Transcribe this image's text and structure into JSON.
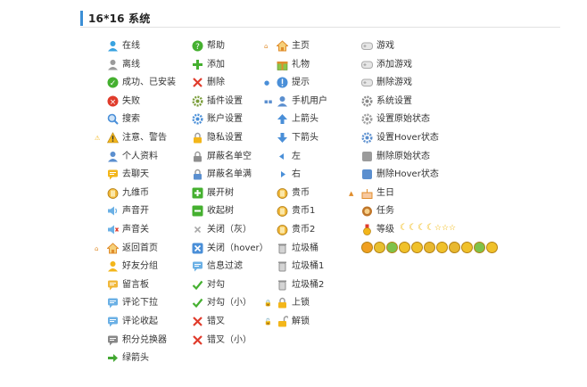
{
  "header": {
    "title": "16*16 系统"
  },
  "columns": [
    {
      "items": [
        {
          "label": "在线",
          "icon": "user-online-icon",
          "color": "#39a3e0"
        },
        {
          "label": "离线",
          "icon": "user-offline-icon",
          "color": "#9b9b9b"
        },
        {
          "label": "成功、已安装",
          "icon": "success-check-icon",
          "color": "#45b030"
        },
        {
          "label": "失败",
          "icon": "fail-x-icon",
          "color": "#e03c2c"
        },
        {
          "label": "搜索",
          "icon": "search-icon",
          "color": "#4a8fd8"
        },
        {
          "label": "注意、警告",
          "icon": "warning-icon",
          "color": "#f3b61a",
          "pre": "⚠"
        },
        {
          "label": "个人资料",
          "icon": "profile-card-icon",
          "color": "#5b8fcf"
        },
        {
          "label": "去聊天",
          "icon": "chat-icon",
          "color": "#f3b61a"
        },
        {
          "label": "九维币",
          "icon": "coin-bag-icon",
          "color": "#f1b83a"
        },
        {
          "label": "声音开",
          "icon": "sound-on-icon",
          "color": "#6bb0e5"
        },
        {
          "label": "声音关",
          "icon": "sound-off-icon",
          "color": "#6bb0e5"
        },
        {
          "label": "返回首页",
          "icon": "home-icon",
          "color": "#e08d2c",
          "pre": "⌂"
        },
        {
          "label": "好友分组",
          "icon": "friends-group-icon",
          "color": "#f3b61a"
        },
        {
          "label": "留言板",
          "icon": "message-board-icon",
          "color": "#f1b83a"
        },
        {
          "label": "评论下拉",
          "icon": "comment-expand-icon",
          "color": "#6bb0e5"
        },
        {
          "label": "评论收起",
          "icon": "comment-collapse-icon",
          "color": "#6bb0e5"
        },
        {
          "label": "积分兑换器",
          "icon": "points-exchange-icon",
          "color": "#888888"
        },
        {
          "label": "绿箭头",
          "icon": "green-arrow-icon",
          "color": "#43a832"
        }
      ]
    },
    {
      "items": [
        {
          "label": "帮助",
          "icon": "help-icon",
          "color": "#45b030"
        },
        {
          "label": "添加",
          "icon": "add-icon",
          "color": "#45b030"
        },
        {
          "label": "删除",
          "icon": "delete-icon",
          "color": "#e03c2c"
        },
        {
          "label": "插件设置",
          "icon": "plugin-settings-icon",
          "color": "#7a9d3a"
        },
        {
          "label": "账户设置",
          "icon": "account-settings-icon",
          "color": "#4a8fd8"
        },
        {
          "label": "隐私设置",
          "icon": "privacy-lock-icon",
          "color": "#f3b61a"
        },
        {
          "label": "屏蔽名单空",
          "icon": "blocklist-empty-icon",
          "color": "#8f8f8f"
        },
        {
          "label": "屏蔽名单满",
          "icon": "blocklist-full-icon",
          "color": "#5b8fcf"
        },
        {
          "label": "展开树",
          "icon": "expand-tree-icon",
          "color": "#45b030"
        },
        {
          "label": "收起树",
          "icon": "collapse-tree-icon",
          "color": "#45b030"
        },
        {
          "label": "关闭（灰）",
          "icon": "close-gray-icon",
          "color": "#aaaaaa"
        },
        {
          "label": "关闭（hover）",
          "icon": "close-hover-icon",
          "color": "#4a8fd8"
        },
        {
          "label": "信息过滤",
          "icon": "info-filter-icon",
          "color": "#6bb0e5"
        },
        {
          "label": "对勾",
          "icon": "checkmark-icon",
          "color": "#45b030"
        },
        {
          "label": "对勾（小）",
          "icon": "checkmark-small-icon",
          "color": "#45b030"
        },
        {
          "label": "错叉",
          "icon": "cross-icon",
          "color": "#e03c2c"
        },
        {
          "label": "错叉（小）",
          "icon": "cross-small-icon",
          "color": "#e03c2c"
        }
      ]
    },
    {
      "items": [
        {
          "label": "主页",
          "icon": "homepage-icon",
          "color": "#e08d2c",
          "pre": "⌂"
        },
        {
          "label": "礼物",
          "icon": "gift-icon",
          "color": "#e08d2c"
        },
        {
          "label": "提示",
          "icon": "tip-icon",
          "color": "#4a8fd8",
          "pre": "●"
        },
        {
          "label": "手机用户",
          "icon": "mobile-user-icon",
          "color": "#5b8fcf",
          "pre": "▪▪"
        },
        {
          "label": "上箭头",
          "icon": "arrow-up-icon",
          "color": "#4a8fd8"
        },
        {
          "label": "下箭头",
          "icon": "arrow-down-icon",
          "color": "#4a8fd8"
        },
        {
          "label": "左",
          "icon": "arrow-left-icon",
          "color": "#4a8fd8"
        },
        {
          "label": "右",
          "icon": "arrow-right-icon",
          "color": "#4a8fd8"
        },
        {
          "label": "贵币",
          "icon": "precious-coin-icon",
          "color": "#f1b83a"
        },
        {
          "label": "贵币1",
          "icon": "precious-coin-1-icon",
          "color": "#f1b83a"
        },
        {
          "label": "贵币2",
          "icon": "precious-coin-2-icon",
          "color": "#f1b83a"
        },
        {
          "label": "垃圾桶",
          "icon": "trash-icon",
          "color": "#8f8f8f"
        },
        {
          "label": "垃圾桶1",
          "icon": "trash-1-icon",
          "color": "#8f8f8f"
        },
        {
          "label": "垃圾桶2",
          "icon": "trash-2-icon",
          "color": "#8f8f8f"
        },
        {
          "label": "上锁",
          "icon": "lock-icon",
          "color": "#f3b61a",
          "pre": "🔒"
        },
        {
          "label": "解锁",
          "icon": "unlock-icon",
          "color": "#f3b61a",
          "pre": "🔓"
        }
      ]
    },
    {
      "items": [
        {
          "label": "游戏",
          "icon": "game-icon",
          "color": "#aaaaaa"
        },
        {
          "label": "添加游戏",
          "icon": "add-game-icon",
          "color": "#aaaaaa"
        },
        {
          "label": "删除游戏",
          "icon": "delete-game-icon",
          "color": "#aaaaaa"
        },
        {
          "label": "系统设置",
          "icon": "system-settings-icon",
          "color": "#888888"
        },
        {
          "label": "设置原始状态",
          "icon": "settings-original-icon",
          "color": "#9b9b9b"
        },
        {
          "label": "设置Hover状态",
          "icon": "settings-hover-icon",
          "color": "#5b8fcf"
        },
        {
          "label": "删除原始状态",
          "icon": "delete-original-icon",
          "color": "#9b9b9b"
        },
        {
          "label": "删除Hover状态",
          "icon": "delete-hover-icon",
          "color": "#5b8fcf"
        },
        {
          "label": "生日",
          "icon": "birthday-cake-icon",
          "color": "#e08d2c",
          "pre": "▲"
        },
        {
          "label": "任务",
          "icon": "task-icon",
          "color": "#c0762a"
        },
        {
          "label": "等级",
          "icon": "level-medal-icon",
          "color": "#e03c2c",
          "levels": true
        }
      ]
    }
  ]
}
